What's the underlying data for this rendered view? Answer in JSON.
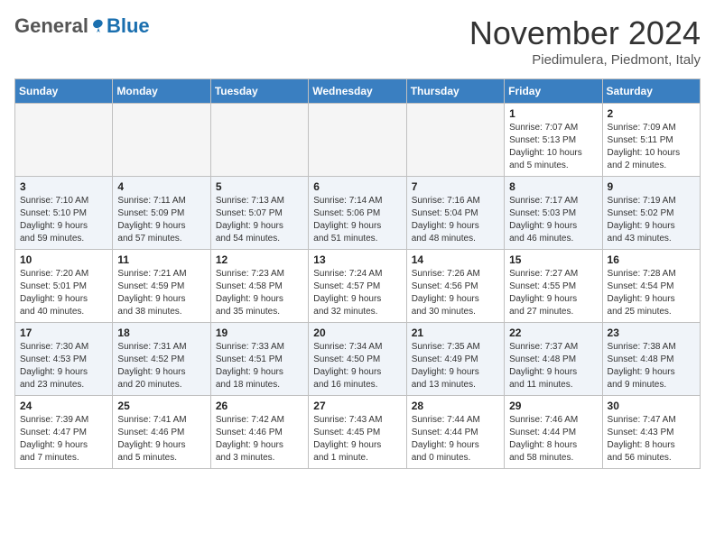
{
  "header": {
    "logo_general": "General",
    "logo_blue": "Blue",
    "month_title": "November 2024",
    "location": "Piedimulera, Piedmont, Italy"
  },
  "weekdays": [
    "Sunday",
    "Monday",
    "Tuesday",
    "Wednesday",
    "Thursday",
    "Friday",
    "Saturday"
  ],
  "weeks": [
    [
      {
        "day": "",
        "info": ""
      },
      {
        "day": "",
        "info": ""
      },
      {
        "day": "",
        "info": ""
      },
      {
        "day": "",
        "info": ""
      },
      {
        "day": "",
        "info": ""
      },
      {
        "day": "1",
        "info": "Sunrise: 7:07 AM\nSunset: 5:13 PM\nDaylight: 10 hours\nand 5 minutes."
      },
      {
        "day": "2",
        "info": "Sunrise: 7:09 AM\nSunset: 5:11 PM\nDaylight: 10 hours\nand 2 minutes."
      }
    ],
    [
      {
        "day": "3",
        "info": "Sunrise: 7:10 AM\nSunset: 5:10 PM\nDaylight: 9 hours\nand 59 minutes."
      },
      {
        "day": "4",
        "info": "Sunrise: 7:11 AM\nSunset: 5:09 PM\nDaylight: 9 hours\nand 57 minutes."
      },
      {
        "day": "5",
        "info": "Sunrise: 7:13 AM\nSunset: 5:07 PM\nDaylight: 9 hours\nand 54 minutes."
      },
      {
        "day": "6",
        "info": "Sunrise: 7:14 AM\nSunset: 5:06 PM\nDaylight: 9 hours\nand 51 minutes."
      },
      {
        "day": "7",
        "info": "Sunrise: 7:16 AM\nSunset: 5:04 PM\nDaylight: 9 hours\nand 48 minutes."
      },
      {
        "day": "8",
        "info": "Sunrise: 7:17 AM\nSunset: 5:03 PM\nDaylight: 9 hours\nand 46 minutes."
      },
      {
        "day": "9",
        "info": "Sunrise: 7:19 AM\nSunset: 5:02 PM\nDaylight: 9 hours\nand 43 minutes."
      }
    ],
    [
      {
        "day": "10",
        "info": "Sunrise: 7:20 AM\nSunset: 5:01 PM\nDaylight: 9 hours\nand 40 minutes."
      },
      {
        "day": "11",
        "info": "Sunrise: 7:21 AM\nSunset: 4:59 PM\nDaylight: 9 hours\nand 38 minutes."
      },
      {
        "day": "12",
        "info": "Sunrise: 7:23 AM\nSunset: 4:58 PM\nDaylight: 9 hours\nand 35 minutes."
      },
      {
        "day": "13",
        "info": "Sunrise: 7:24 AM\nSunset: 4:57 PM\nDaylight: 9 hours\nand 32 minutes."
      },
      {
        "day": "14",
        "info": "Sunrise: 7:26 AM\nSunset: 4:56 PM\nDaylight: 9 hours\nand 30 minutes."
      },
      {
        "day": "15",
        "info": "Sunrise: 7:27 AM\nSunset: 4:55 PM\nDaylight: 9 hours\nand 27 minutes."
      },
      {
        "day": "16",
        "info": "Sunrise: 7:28 AM\nSunset: 4:54 PM\nDaylight: 9 hours\nand 25 minutes."
      }
    ],
    [
      {
        "day": "17",
        "info": "Sunrise: 7:30 AM\nSunset: 4:53 PM\nDaylight: 9 hours\nand 23 minutes."
      },
      {
        "day": "18",
        "info": "Sunrise: 7:31 AM\nSunset: 4:52 PM\nDaylight: 9 hours\nand 20 minutes."
      },
      {
        "day": "19",
        "info": "Sunrise: 7:33 AM\nSunset: 4:51 PM\nDaylight: 9 hours\nand 18 minutes."
      },
      {
        "day": "20",
        "info": "Sunrise: 7:34 AM\nSunset: 4:50 PM\nDaylight: 9 hours\nand 16 minutes."
      },
      {
        "day": "21",
        "info": "Sunrise: 7:35 AM\nSunset: 4:49 PM\nDaylight: 9 hours\nand 13 minutes."
      },
      {
        "day": "22",
        "info": "Sunrise: 7:37 AM\nSunset: 4:48 PM\nDaylight: 9 hours\nand 11 minutes."
      },
      {
        "day": "23",
        "info": "Sunrise: 7:38 AM\nSunset: 4:48 PM\nDaylight: 9 hours\nand 9 minutes."
      }
    ],
    [
      {
        "day": "24",
        "info": "Sunrise: 7:39 AM\nSunset: 4:47 PM\nDaylight: 9 hours\nand 7 minutes."
      },
      {
        "day": "25",
        "info": "Sunrise: 7:41 AM\nSunset: 4:46 PM\nDaylight: 9 hours\nand 5 minutes."
      },
      {
        "day": "26",
        "info": "Sunrise: 7:42 AM\nSunset: 4:46 PM\nDaylight: 9 hours\nand 3 minutes."
      },
      {
        "day": "27",
        "info": "Sunrise: 7:43 AM\nSunset: 4:45 PM\nDaylight: 9 hours\nand 1 minute."
      },
      {
        "day": "28",
        "info": "Sunrise: 7:44 AM\nSunset: 4:44 PM\nDaylight: 9 hours\nand 0 minutes."
      },
      {
        "day": "29",
        "info": "Sunrise: 7:46 AM\nSunset: 4:44 PM\nDaylight: 8 hours\nand 58 minutes."
      },
      {
        "day": "30",
        "info": "Sunrise: 7:47 AM\nSunset: 4:43 PM\nDaylight: 8 hours\nand 56 minutes."
      }
    ]
  ]
}
